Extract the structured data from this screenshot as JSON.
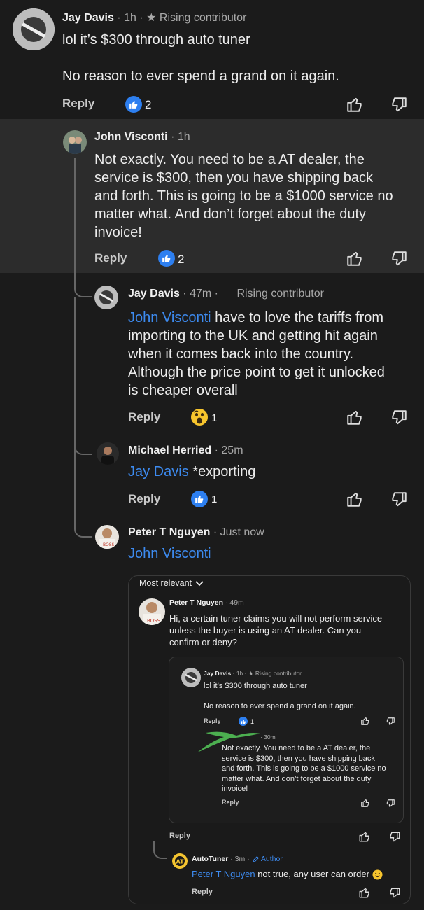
{
  "comments": {
    "jay1": {
      "name": "Jay Davis",
      "time": "1h",
      "badge": "Rising contributor",
      "line1": "lol it’s $300 through auto tuner",
      "line2": "No reason to ever spend a grand on it again.",
      "reply": "Reply",
      "likes": "2"
    },
    "john": {
      "name": "John Visconti",
      "time": "1h",
      "lines": [
        "Not exactly. You need to be a AT dealer, the",
        "service is $300, then you have shipping back",
        "and forth. This is going to be a $1000 service no",
        "matter what. And don’t forget about the duty",
        "invoice!"
      ],
      "reply": "Reply",
      "likes": "2"
    },
    "jay2": {
      "name": "Jay Davis",
      "time": "47m",
      "badge": "Rising contributor",
      "mention": "John Visconti",
      "lines": [
        "have to love the tariffs from",
        "importing to the UK and getting hit again",
        "when it comes back into the country.",
        "Although the price point to get it unlocked",
        "is cheaper overall"
      ],
      "reply": "Reply",
      "reactions": "1"
    },
    "michael": {
      "name": "Michael Herried",
      "time": "25m",
      "mention": "Jay Davis",
      "text": "*exporting",
      "reply": "Reply",
      "likes": "1"
    },
    "peter": {
      "name": "Peter T Nguyen",
      "time": "Just now",
      "mention": "John Visconti"
    }
  },
  "embed": {
    "sort_label": "Most relevant",
    "peter": {
      "name": "Peter T Nguyen",
      "time": "49m",
      "lines": [
        "Hi, a certain tuner claims you will not perform service",
        "unless the buyer is using an AT dealer. Can you",
        "confirm or deny?"
      ],
      "reply": "Reply"
    },
    "inner_jay": {
      "name": "Jay Davis",
      "time": "1h",
      "badge": "Rising contributor",
      "line1": "lol it’s $300 through auto tuner",
      "line2": "No reason to ever spend a grand on it again.",
      "reply": "Reply",
      "likes": "1"
    },
    "inner_john": {
      "time": "30m",
      "lines": [
        "Not exactly. You need to be a AT dealer, the",
        "service is $300, then you have shipping back",
        "and forth. This is going to be a $1000 service no",
        "matter what. And don’t forget about the duty",
        "invoice!"
      ],
      "reply": "Reply"
    },
    "autotuner": {
      "name": "AutoTuner",
      "time": "3m",
      "author_label": "Author",
      "mention": "Peter T Nguyen",
      "text": "not true, any user can order",
      "reply": "Reply"
    }
  },
  "colors": {
    "background": "#1b1b1b",
    "highlight": "#2c2c2c",
    "mention": "#3d8bf0",
    "like_badge": "#2d7ff0"
  }
}
